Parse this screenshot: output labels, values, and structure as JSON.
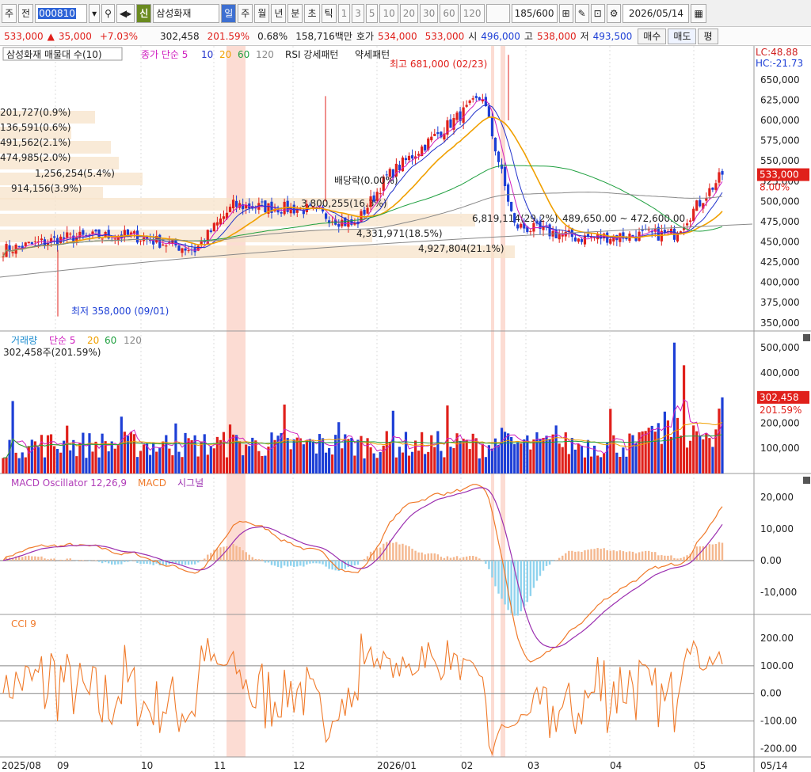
{
  "toolbar": {
    "period": "주",
    "whole": "전",
    "code": "000810",
    "stock_badge": "신",
    "stock_name": "삼성화재",
    "tabs": [
      "일",
      "주",
      "월",
      "년",
      "분",
      "초",
      "틱"
    ],
    "intervals": [
      "1",
      "3",
      "5",
      "10",
      "20",
      "30",
      "60",
      "120"
    ],
    "count": "185/600",
    "date": "2026/05/14"
  },
  "quote": {
    "price": "533,000",
    "change": "35,000",
    "change_pct": "+7.03%",
    "volume": "302,458",
    "volume_pct": "201.59%",
    "turnover_pct": "0.68%",
    "amount": "158,716백만",
    "ask_label": "호가",
    "ask": "534,000",
    "bid": "533,000",
    "open_label": "시",
    "open": "496,000",
    "high_label": "고",
    "high": "538,000",
    "low_label": "저",
    "low": "493,500",
    "buy_button": "매수",
    "sell_button": "매도",
    "eval_button": "평"
  },
  "colors": {
    "up": "#e0201b",
    "down": "#1d3fd6",
    "ma5": "#d020c0",
    "ma10": "#2233cc",
    "ma20": "#f0a000",
    "ma60": "#20a040",
    "ma120": "#888888",
    "highlight": "#fbd3c8"
  },
  "legends": {
    "price": [
      "삼성화재 매물대 수(10)",
      "종가 단순 5",
      "10",
      "20",
      "60",
      "120",
      "RSI 강세패턴",
      "약세패턴"
    ],
    "volume": [
      "거래량",
      "단순 5",
      "20",
      "60",
      "120"
    ],
    "volume_value": "302,458주(201.59%)",
    "macd": [
      "MACD Oscillator 12,26,9",
      "MACD",
      "시그널"
    ],
    "cci": "CCI 9"
  },
  "corner": {
    "lc": "LC:48.88",
    "hc": "HC:-21.73"
  },
  "price_axis": [
    "650,000",
    "625,000",
    "600,000",
    "575,000",
    "550,000",
    "525,000",
    "500,000",
    "475,000",
    "450,000",
    "425,000",
    "400,000",
    "375,000",
    "350,000"
  ],
  "price_label": {
    "value": "533,000",
    "pct": "8.00%"
  },
  "volume_axis": [
    "500,000",
    "400,000",
    "300,000",
    "200,000",
    "100,000"
  ],
  "volume_label": {
    "value": "302,458",
    "pct": "201.59%"
  },
  "macd_axis": [
    "20,000",
    "10,000",
    "0.00",
    "-10,000"
  ],
  "cci_axis": [
    "200.00",
    "100.00",
    "0.00",
    "-100.00",
    "-200.00"
  ],
  "date_axis": [
    "2025/08",
    "09",
    "10",
    "11",
    "12",
    "2026/01",
    "02",
    "03",
    "04",
    "05",
    "05/14"
  ],
  "annotations": {
    "high": "최고 681,000 (02/23)",
    "low": "최저 358,000 (09/01)",
    "dividend": "배당락(0.00%)"
  },
  "volume_profile": [
    "201,727(0.9%)",
    "136,591(0.6%)",
    "491,562(2.1%)",
    "474,985(2.0%)",
    "1,256,254(5.4%)",
    "914,156(3.9%)",
    "3,800,255(16.3%)",
    "6,819,114(29.2%)",
    "4,331,971(18.5%)",
    "4,927,804(21.1%)"
  ],
  "range_note": "489,650.00 ~ 472,600.00",
  "chart_data": [
    {
      "type": "candlestick",
      "title": "삼성화재",
      "ylim": [
        340000,
        690000
      ],
      "x": [
        "2025/08",
        "09",
        "10",
        "11",
        "12",
        "2026/01",
        "02",
        "03",
        "04",
        "05"
      ],
      "close_approx": [
        440000,
        455000,
        458000,
        440000,
        495000,
        490000,
        530000,
        630000,
        470000,
        455000,
        533000
      ],
      "high": 681000,
      "low": 358000,
      "last": 533000
    },
    {
      "type": "bar",
      "title": "거래량",
      "ylim": [
        0,
        560000
      ],
      "last": 302458,
      "max_approx": 520000
    },
    {
      "type": "line",
      "title": "MACD Oscillator 12,26,9",
      "ylim": [
        -17000,
        27000
      ]
    },
    {
      "type": "line",
      "title": "CCI 9",
      "ylim": [
        -230,
        280
      ]
    }
  ]
}
